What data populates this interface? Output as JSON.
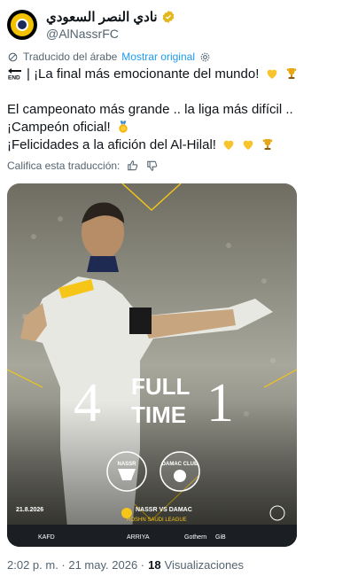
{
  "account": {
    "display_name": "نادي النصر السعودي",
    "handle": "@AlNassrFC",
    "verified_icon": "verified-badge-icon"
  },
  "translation": {
    "label": "Traducido del árabe",
    "show_original": "Mostrar original",
    "rate_label": "Califica esta traducción:"
  },
  "tweet": {
    "line1": "| ¡La final más emocionante del mundo!",
    "line2": "El campeonato más grande .. la liga más difícil ..",
    "line3": "¡Campeón oficial!",
    "line4": "¡Felicidades a la afición del Al-Hilal!"
  },
  "media": {
    "score_home": "4",
    "score_away": "1",
    "status": "FULL",
    "status2": "TIME",
    "date": "21.8.2026",
    "match": "NASSR VS DAMAC",
    "league": "ROSHN SAUDI LEAGUE",
    "home_club": "NASSR",
    "away_club": "DAMAC CLUB",
    "sponsors": [
      "KAFD",
      "ARRIYA",
      "Gothern",
      "GiB"
    ],
    "colors": {
      "yellow": "#f5c518",
      "kit": "#e8e8e3"
    }
  },
  "footer": {
    "time": "2:02 p. m. · 21 may. 2026 ·",
    "views_count": "18",
    "views_label": "Visualizaciones"
  }
}
